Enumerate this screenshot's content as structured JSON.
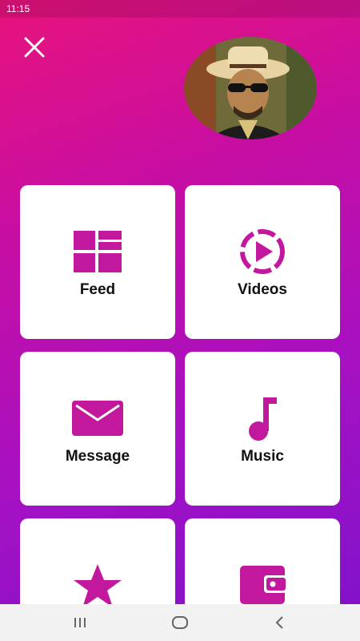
{
  "status_bar": {
    "time": "11:15",
    "right": ""
  },
  "header": {
    "close_icon": "close-icon",
    "avatar": "profile-avatar"
  },
  "tiles": [
    {
      "label": "Feed",
      "icon": "grid-layout-icon"
    },
    {
      "label": "Videos",
      "icon": "play-circle-icon"
    },
    {
      "label": "Message",
      "icon": "envelope-icon"
    },
    {
      "label": "Music",
      "icon": "music-note-icon"
    },
    {
      "label": "",
      "icon": "star-icon"
    },
    {
      "label": "",
      "icon": "wallet-icon"
    }
  ],
  "colors": {
    "accent": "#c2189e",
    "gradient_top": "#e8137c",
    "gradient_bottom": "#7d12cc"
  },
  "navbar": {
    "recents": "recents-icon",
    "home": "home-icon",
    "back": "back-icon"
  }
}
